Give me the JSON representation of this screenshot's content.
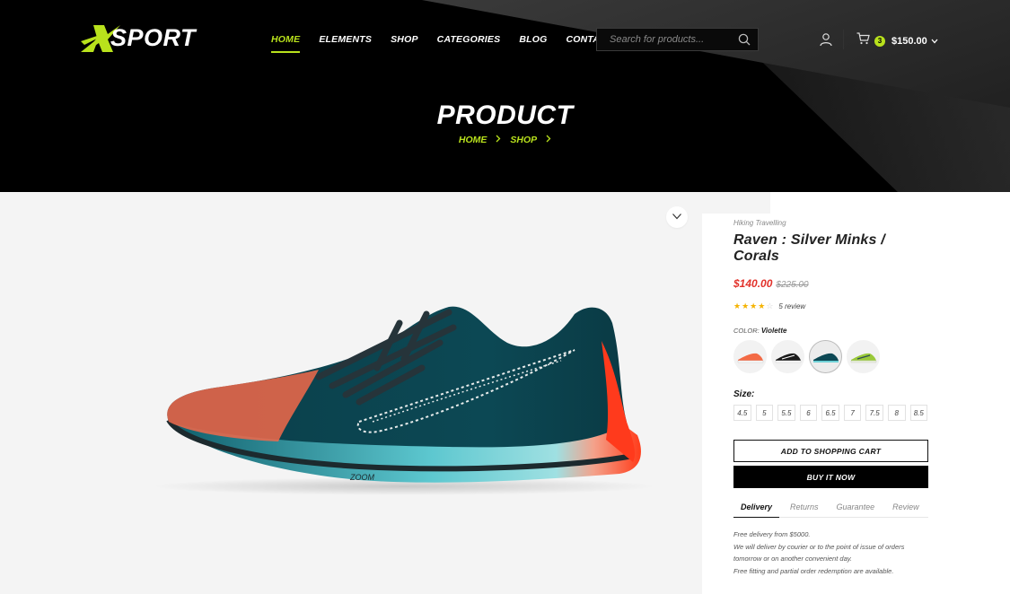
{
  "brand": {
    "name": "SPORT",
    "mark": "X"
  },
  "nav": {
    "items": [
      {
        "label": "HOME",
        "active": true
      },
      {
        "label": "ELEMENTS",
        "active": false
      },
      {
        "label": "SHOP",
        "active": false
      },
      {
        "label": "CATEGORIES",
        "active": false
      },
      {
        "label": "BLOG",
        "active": false
      },
      {
        "label": "CONTACT",
        "active": false
      }
    ]
  },
  "search": {
    "placeholder": "Search for products...",
    "value": ""
  },
  "cart": {
    "count": "3",
    "total": "$150.00"
  },
  "hero": {
    "title": "PRODUCT",
    "breadcrumb": [
      "HOME",
      "SHOP"
    ]
  },
  "product": {
    "category": "Hiking Travelling",
    "title": "Raven : Silver Minks / Corals",
    "price": "$140.00",
    "old_price": "$225.00",
    "rating": 4,
    "rating_max": 5,
    "review_text": "5 review",
    "color_label": "COLOR:",
    "color_value": "Violette",
    "swatches": [
      {
        "name": "orange",
        "active": false
      },
      {
        "name": "black",
        "active": false
      },
      {
        "name": "teal",
        "active": true
      },
      {
        "name": "lime",
        "active": false
      }
    ],
    "size_label": "Size:",
    "sizes": [
      "4.5",
      "5",
      "5.5",
      "6",
      "6.5",
      "7",
      "7.5",
      "8",
      "8.5"
    ],
    "add_to_cart": "ADD TO SHOPPING CART",
    "buy_now": "BUY IT NOW",
    "tabs": [
      {
        "label": "Delivery",
        "active": true
      },
      {
        "label": "Returns",
        "active": false
      },
      {
        "label": "Guarantee",
        "active": false
      },
      {
        "label": "Review",
        "active": false
      }
    ],
    "delivery_lines": [
      "Free delivery from $5000.",
      "We will deliver by courier or to the point of issue of orders",
      "tomorrow or on another convenient day.",
      "Free fitting and partial order redemption are available."
    ]
  },
  "colors": {
    "accent": "#b9e21c",
    "sale": "#e2322b",
    "dark": "#000000",
    "gallery_bg": "#f4f4f4"
  }
}
